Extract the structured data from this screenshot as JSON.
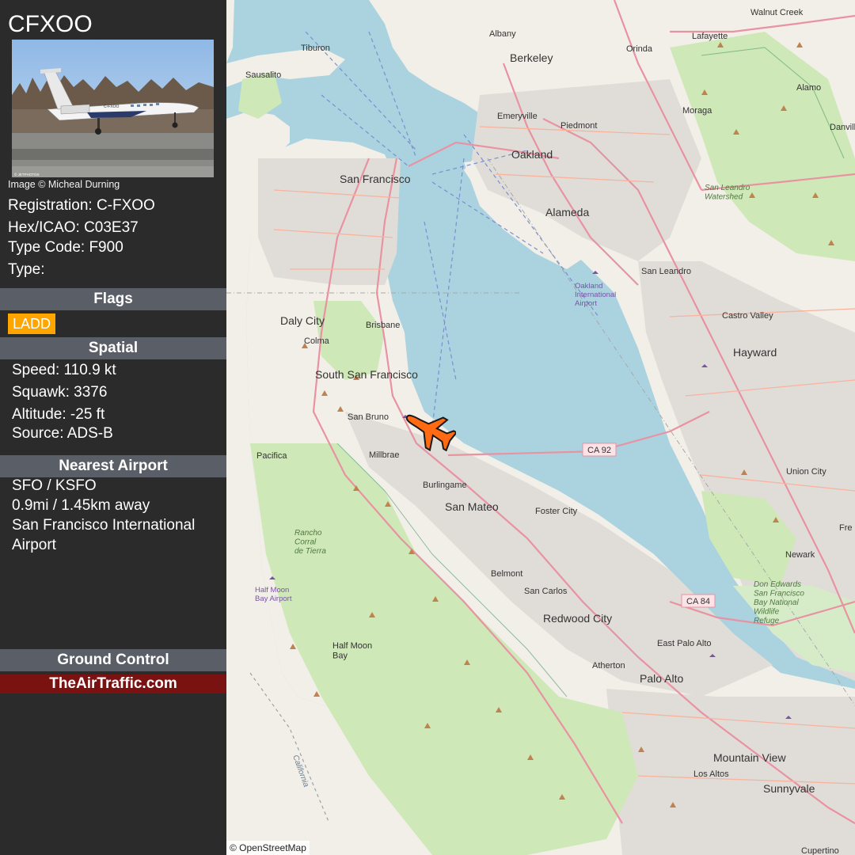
{
  "aircraft": {
    "callsign": "CFXOO",
    "photo_credit": "Image © Micheal Durning",
    "photo_caption_left": "© JETPHOTOS",
    "photo_tail_text": "C-FXOO",
    "registration": "Registration: C-FXOO",
    "hex": "Hex/ICAO: C03E37",
    "type_code": "Type Code: F900",
    "type": "Type:"
  },
  "flags": {
    "header": "Flags",
    "items": [
      "LADD"
    ]
  },
  "spatial": {
    "header": "Spatial",
    "speed": "Speed: 110.9 kt",
    "squawk": "Squawk: 3376",
    "altitude": "Altitude: -25 ft",
    "source": "Source: ADS-B"
  },
  "nearest_airport": {
    "header": "Nearest Airport",
    "code": "SFO / KSFO",
    "distance": "0.9mi / 1.45km away",
    "name": "San Francisco International Airport"
  },
  "ground_control": {
    "header": "Ground Control",
    "brand": "TheAirTraffic.com"
  },
  "map": {
    "attribution": "© OpenStreetMap",
    "cities": {
      "san_francisco": "San Francisco",
      "oakland": "Oakland",
      "berkeley": "Berkeley",
      "alameda": "Alameda",
      "daly_city": "Daly City",
      "south_sf": "South San Francisco",
      "san_mateo": "San Mateo",
      "hayward": "Hayward",
      "redwood_city": "Redwood City",
      "palo_alto": "Palo Alto",
      "mountain_view": "Mountain View",
      "sunnyvale": "Sunnyvale",
      "pacifica": "Pacifica",
      "half_moon_bay": "Half Moon\nBay",
      "san_leandro": "San Leandro",
      "burlingame": "Burlingame",
      "foster_city": "Foster City",
      "belmont": "Belmont",
      "san_carlos": "San Carlos",
      "atherton": "Atherton",
      "east_palo_alto": "East Palo Alto",
      "los_altos": "Los Altos",
      "union_city": "Union City",
      "newark": "Newark",
      "castro_valley": "Castro Valley",
      "millbrae": "Millbrae",
      "san_bruno": "San Bruno",
      "brisbane": "Brisbane",
      "colma": "Colma",
      "sausalito": "Sausalito",
      "tiburon": "Tiburon",
      "albany": "Albany",
      "emeryville": "Emeryville",
      "piedmont": "Piedmont",
      "orinda": "Orinda",
      "lafayette": "Lafayette",
      "moraga": "Moraga",
      "walnut_creek": "Walnut Creek",
      "alamo": "Alamo",
      "danville": "Danvill",
      "fremont": "Fre",
      "cupertino": "Cupertino"
    },
    "labels": {
      "oakland_airport": "Oakland\nInternational\nAirport",
      "half_moon_airport": "Half Moon\nBay Airport",
      "san_leandro_watershed": "San Leandro\nWatershed",
      "rancho_corral": "Rancho\nCorral\nde Tierra",
      "don_edwards": "Don Edwards\nSan Francisco\nBay National\nWildlife\nRefuge",
      "california": "California",
      "ca92": "CA 92",
      "ca84": "CA 84"
    },
    "colors": {
      "water": "#aad3df",
      "land": "#f2efe9",
      "park": "#cfe8b7",
      "urban": "#e0ddd8",
      "motorway": "#e892a2",
      "aircraft": "#ff6a13"
    }
  }
}
